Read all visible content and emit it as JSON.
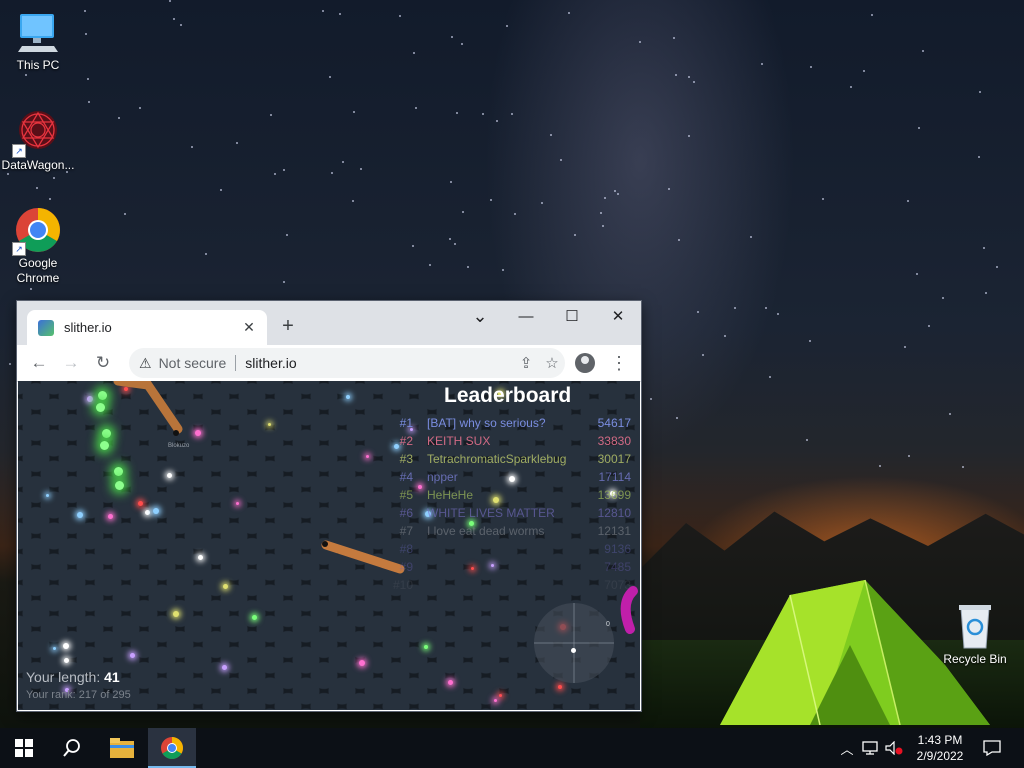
{
  "desktop": {
    "icons": [
      {
        "label": "This PC",
        "icon": "computer-icon"
      },
      {
        "label": "DataWagon...",
        "icon": "datawagon-icon"
      },
      {
        "label": "Google Chrome",
        "icon": "chrome-icon"
      },
      {
        "label": "Recycle Bin",
        "icon": "recycle-bin-icon"
      }
    ]
  },
  "browser": {
    "tab_title": "slither.io",
    "tab_close": "✕",
    "new_tab": "+",
    "security_label": "Not secure",
    "url": "slither.io",
    "window_controls": {
      "minimize": "—",
      "maximize": "☐",
      "close": "✕"
    },
    "dropdown": "⌄"
  },
  "game": {
    "leaderboard_title": "Leaderboard",
    "leaderboard": [
      {
        "rank": "#1",
        "name": "[BAT] why so serious?",
        "score": "54617",
        "color": "#7a8de0"
      },
      {
        "rank": "#2",
        "name": "KEITH SUX",
        "score": "33830",
        "color": "#e06f8b"
      },
      {
        "rank": "#3",
        "name": "TetrachromaticSparklebug",
        "score": "30017",
        "color": "#b7c46a"
      },
      {
        "rank": "#4",
        "name": "npper",
        "score": "17114",
        "color": "#7a7fd6"
      },
      {
        "rank": "#5",
        "name": "HeHeHe",
        "score": "13699",
        "color": "#a5c15c"
      },
      {
        "rank": "#6",
        "name": "WHITE LIVES MATTER",
        "score": "12810",
        "color": "#7870c8"
      },
      {
        "rank": "#7",
        "name": "I love eat dead worms",
        "score": "12131",
        "color": "#8b8f96"
      },
      {
        "rank": "#8",
        "name": "",
        "score": "9136",
        "color": "#5d5ea8"
      },
      {
        "rank": "#9",
        "name": "",
        "score": "7485",
        "color": "#6a5fb8"
      },
      {
        "rank": "#10",
        "name": "",
        "score": "7073",
        "color": "#5a5f6a"
      }
    ],
    "snake_name": "Blokuzo",
    "length_label": "Your length:",
    "length_value": "41",
    "rank_text": "Your rank: 217 of 295",
    "minimap_label": "0"
  },
  "taskbar": {
    "items": [
      "start-icon",
      "search-icon",
      "file-explorer-icon",
      "chrome-icon"
    ],
    "time": "1:43 PM",
    "date": "2/9/2022"
  },
  "colors": {
    "taskbar_bg": "#0c1016",
    "accent": "#76b9ed",
    "snake": "#c47a3e"
  }
}
